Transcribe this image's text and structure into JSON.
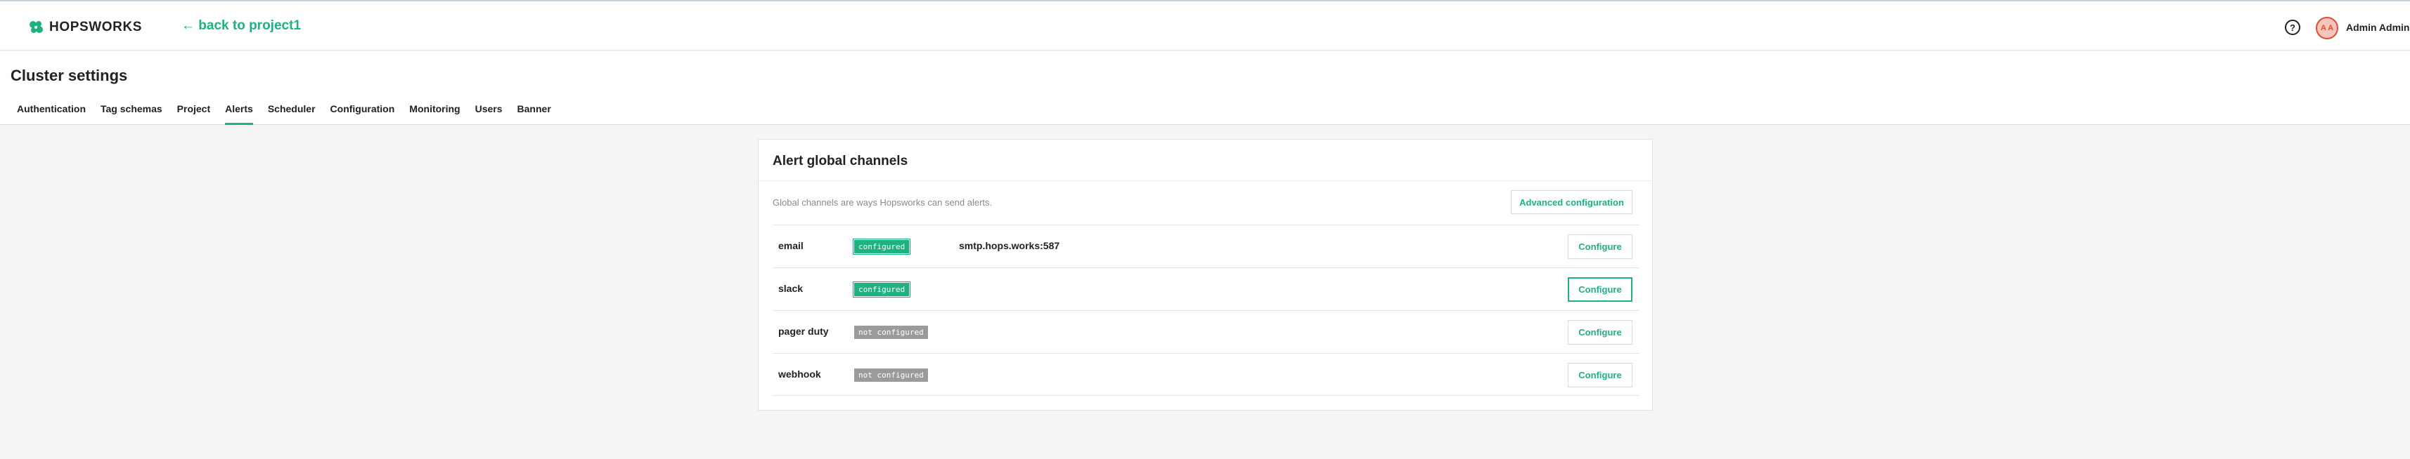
{
  "topbar": {
    "logo_text": "HOPSWORKS",
    "back_link": "← back to project1",
    "help_icon": "?",
    "avatar_initials": "A A",
    "user_name": "Admin Admin"
  },
  "header": {
    "title": "Cluster settings",
    "tabs": [
      {
        "label": "Authentication"
      },
      {
        "label": "Tag schemas"
      },
      {
        "label": "Project"
      },
      {
        "label": "Alerts",
        "active": true
      },
      {
        "label": "Scheduler"
      },
      {
        "label": "Configuration"
      },
      {
        "label": "Monitoring"
      },
      {
        "label": "Users"
      },
      {
        "label": "Banner"
      }
    ]
  },
  "card": {
    "title": "Alert global channels",
    "description": "Global channels are ways Hopsworks can send alerts.",
    "advanced_button": "Advanced configuration",
    "channels": [
      {
        "name": "email",
        "status": "configured",
        "detail": "smtp.hops.works:587",
        "button": "Configure"
      },
      {
        "name": "slack",
        "status": "configured",
        "detail": "",
        "button": "Configure"
      },
      {
        "name": "pager duty",
        "status": "not configured",
        "detail": "",
        "button": "Configure"
      },
      {
        "name": "webhook",
        "status": "not configured",
        "detail": "",
        "button": "Configure"
      }
    ]
  },
  "colors": {
    "accent": "#1eb182",
    "badge_off": "#9b9b9b",
    "avatar_border": "#e04e32"
  },
  "icons": [
    "hopsworks-logo-icon",
    "arrow-left-icon",
    "help-circle-icon"
  ]
}
